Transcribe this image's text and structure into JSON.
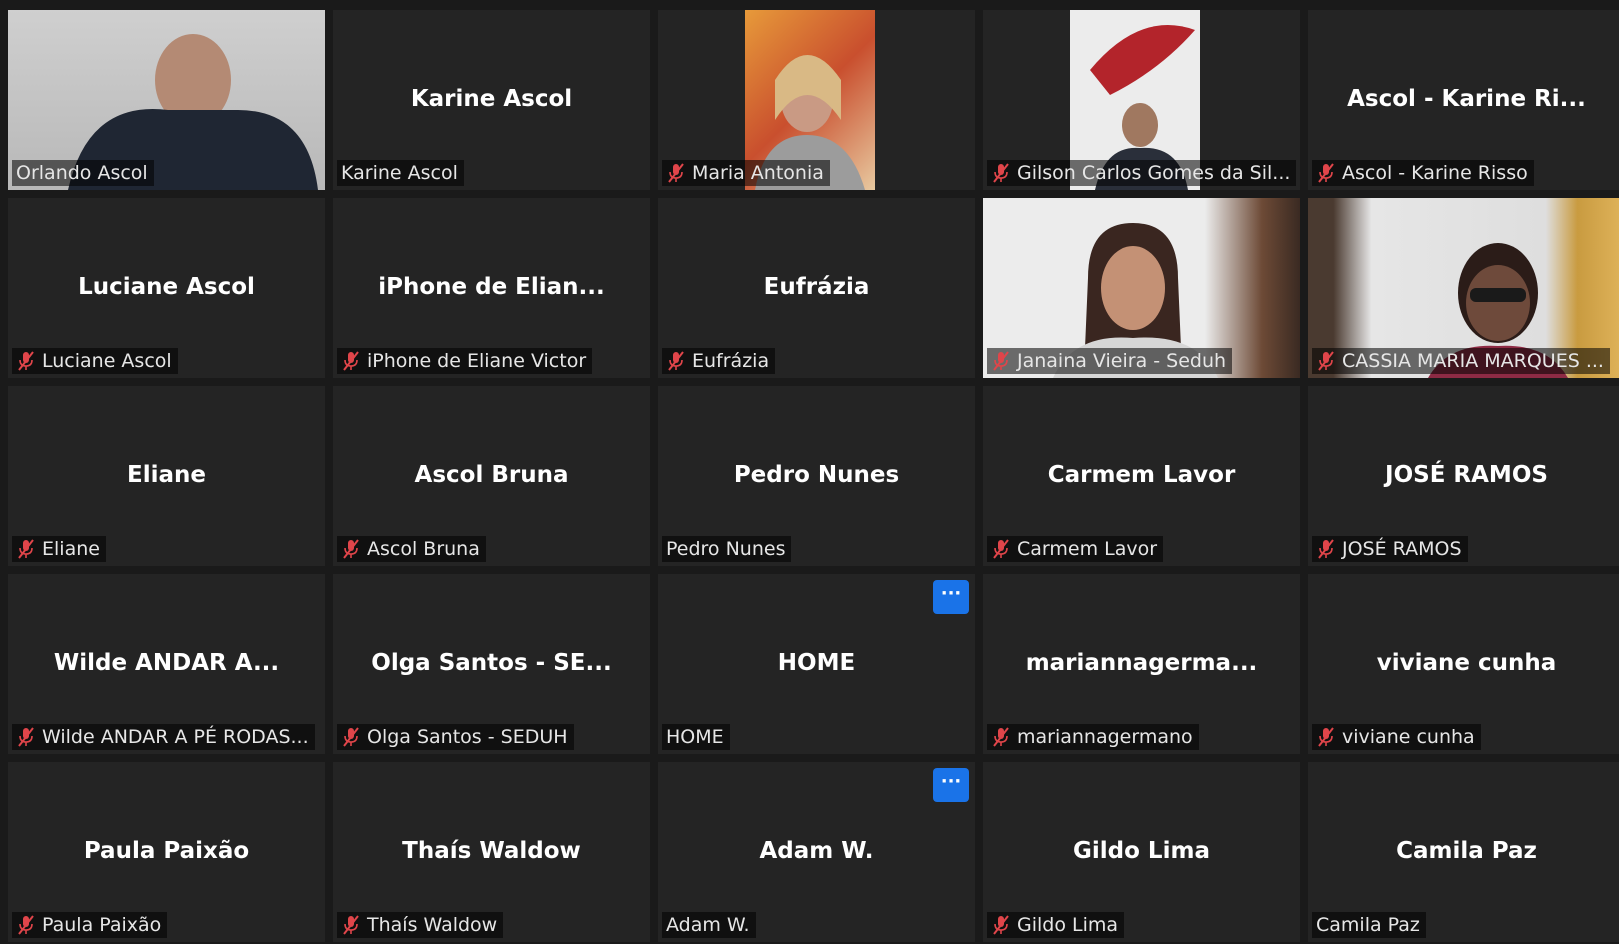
{
  "tiles": [
    {
      "display": "",
      "tag": "Orlando Ascol",
      "muted": false
    },
    {
      "display": "Karine Ascol",
      "tag": "Karine Ascol",
      "muted": false
    },
    {
      "display": "",
      "tag": "Maria Antonia",
      "muted": true
    },
    {
      "display": "",
      "tag": "Gilson Carlos Gomes da Sil...",
      "muted": true
    },
    {
      "display": "Ascol - Karine Ri...",
      "tag": "Ascol - Karine Risso",
      "muted": true
    },
    {
      "display": "Luciane Ascol",
      "tag": "Luciane Ascol",
      "muted": true
    },
    {
      "display": "iPhone de Elian...",
      "tag": "iPhone de Eliane Victor",
      "muted": true
    },
    {
      "display": "Eufrázia",
      "tag": "Eufrázia",
      "muted": true
    },
    {
      "display": "",
      "tag": "Janaina Vieira - Seduh",
      "muted": true
    },
    {
      "display": "",
      "tag": "CASSIA MARIA MARQUES ...",
      "muted": true
    },
    {
      "display": "Eliane",
      "tag": "Eliane",
      "muted": true
    },
    {
      "display": "Ascol Bruna",
      "tag": "Ascol Bruna",
      "muted": true
    },
    {
      "display": "Pedro Nunes",
      "tag": "Pedro Nunes",
      "muted": false
    },
    {
      "display": "Carmem Lavor",
      "tag": "Carmem Lavor",
      "muted": true
    },
    {
      "display": "JOSÉ RAMOS",
      "tag": "JOSÉ RAMOS",
      "muted": true
    },
    {
      "display": "Wilde ANDAR A...",
      "tag": "Wilde ANDAR A PÉ RODAS...",
      "muted": true
    },
    {
      "display": "Olga Santos - SE...",
      "tag": "Olga Santos - SEDUH",
      "muted": true
    },
    {
      "display": "HOME",
      "tag": "HOME",
      "muted": false
    },
    {
      "display": "mariannagerma...",
      "tag": "mariannagermano",
      "muted": true
    },
    {
      "display": "viviane cunha",
      "tag": "viviane cunha",
      "muted": true
    },
    {
      "display": "Paula Paixão",
      "tag": "Paula Paixão",
      "muted": true
    },
    {
      "display": "Thaís Waldow",
      "tag": "Thaís Waldow",
      "muted": true
    },
    {
      "display": "Adam W.",
      "tag": "Adam W.",
      "muted": false
    },
    {
      "display": "Gildo Lima",
      "tag": "Gildo Lima",
      "muted": true
    },
    {
      "display": "Camila Paz",
      "tag": "Camila Paz",
      "muted": false
    }
  ],
  "more_label": "···",
  "colors": {
    "active_border": "#d8ec6b",
    "muted_icon": "#e0454a",
    "more_button": "#1a73e8",
    "tile_bg": "#242424"
  }
}
